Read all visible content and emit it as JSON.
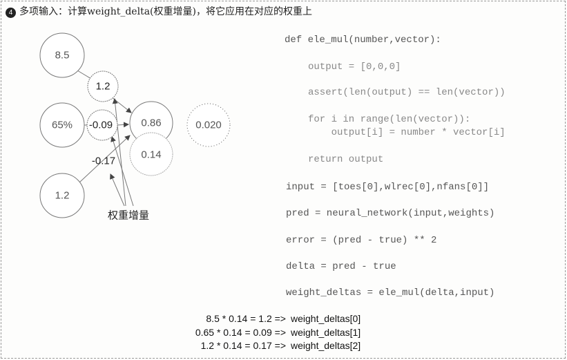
{
  "title": {
    "badge": "4",
    "text": "多项输入：计算weight_delta(权重增量)，将它应用在对应的权重上"
  },
  "diagram": {
    "inputs": [
      "8.5",
      "65%",
      "1.2"
    ],
    "weight_deltas": [
      "1.2",
      "-0.09",
      "-0.17"
    ],
    "prediction": "0.86",
    "delta": "0.14",
    "error": "0.020",
    "annotation": "权重增量"
  },
  "code": [
    "def ele_mul(number,vector):",
    "output = [0,0,0]",
    "assert(len(output) == len(vector))",
    "for i in range(len(vector)):",
    "    output[i] = number * vector[i]",
    "return output",
    "input = [toes[0],wlrec[0],nfans[0]]",
    "pred = neural_network(input,weights)",
    "error = (pred - true) ** 2",
    "delta = pred - true",
    "weight_deltas = ele_mul(delta,input)"
  ],
  "calculations": [
    {
      "expr": "8.5 * 0.14 = 1.2 =>",
      "target": "weight_deltas[0]"
    },
    {
      "expr": "0.65 * 0.14 = 0.09 =>",
      "target": "weight_deltas[1]"
    },
    {
      "expr": "1.2 * 0.14 = 0.17 =>",
      "target": "weight_deltas[2]"
    }
  ]
}
